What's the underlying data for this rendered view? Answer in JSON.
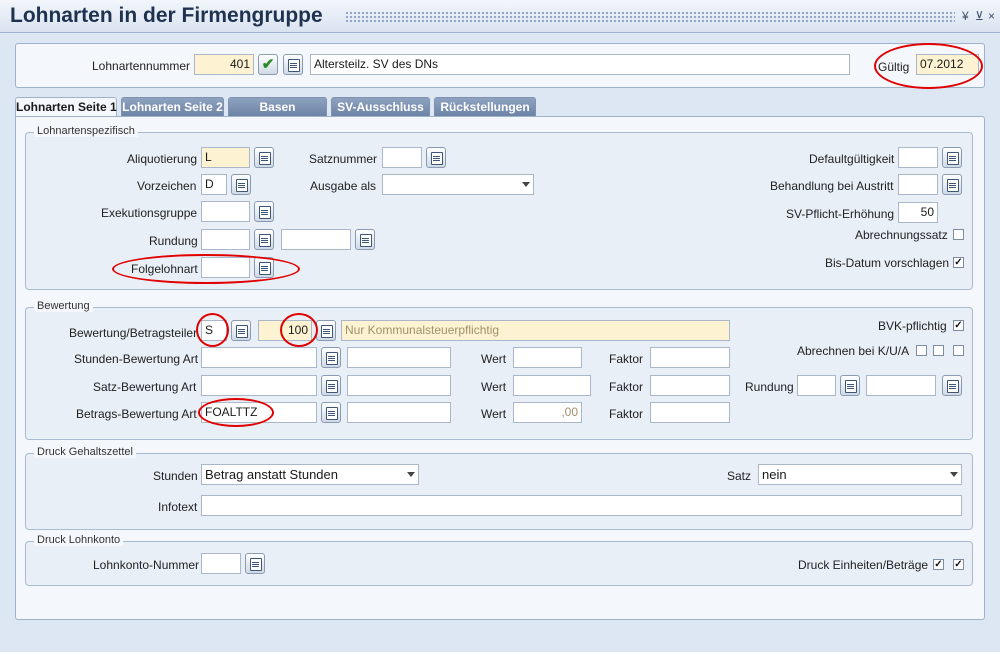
{
  "window": {
    "title": "Lohnarten in der Firmengruppe",
    "controls": [
      "¥",
      "⊻",
      "×"
    ]
  },
  "header": {
    "lohnartennummer_label": "Lohnartennummer",
    "lohnartennummer_value": "401",
    "description_value": "Altersteilz. SV des DNs",
    "gueltig_label": "Gültig",
    "gueltig_value": "07.2012"
  },
  "tabs": [
    {
      "label": "Lohnarten Seite 1",
      "active": true
    },
    {
      "label": "Lohnarten Seite 2",
      "active": false
    },
    {
      "label": "Basen",
      "active": false
    },
    {
      "label": "SV-Ausschluss",
      "active": false
    },
    {
      "label": "Rückstellungen",
      "active": false
    }
  ],
  "lohnartenspezifisch": {
    "legend": "Lohnartenspezifisch",
    "aliquotierung_label": "Aliquotierung",
    "aliquotierung_value": "L",
    "vorzeichen_label": "Vorzeichen",
    "vorzeichen_value": "D",
    "exekutionsgruppe_label": "Exekutionsgruppe",
    "exekutionsgruppe_value": "",
    "rundung_label": "Rundung",
    "rundung_value": "",
    "rundung_value2": "",
    "folgelohnart_label": "Folgelohnart",
    "folgelohnart_value": "",
    "satznummer_label": "Satznummer",
    "satznummer_value": "",
    "ausgabe_als_label": "Ausgabe als",
    "ausgabe_als_value": "",
    "defaultgueltigkeit_label": "Defaultgültigkeit",
    "defaultgueltigkeit_value": "",
    "behandlung_label": "Behandlung bei Austritt",
    "behandlung_value": "",
    "sv_pflicht_label": "SV-Pflicht-Erhöhung",
    "sv_pflicht_value": "50",
    "abrechnungssatz_label": "Abrechnungssatz",
    "abrechnungssatz_checked": false,
    "bis_datum_label": "Bis-Datum vorschlagen",
    "bis_datum_checked": true
  },
  "bewertung": {
    "legend": "Bewertung",
    "betragsteiler_label": "Bewertung/Betragsteiler",
    "betragsteiler_value": "S",
    "betragsteiler_amount": "100",
    "betragsteiler_desc": "Nur Kommunalsteuerpflichtig",
    "stunden_label": "Stunden-Bewertung Art",
    "stunden_value": "",
    "stunden_desc": "",
    "satz_label": "Satz-Bewertung Art",
    "satz_value": "",
    "satz_desc": "",
    "betrags_label": "Betrags-Bewertung Art",
    "betrags_value": "FOALTTZ",
    "betrags_desc": "",
    "wert_label": "Wert",
    "stunden_wert": "",
    "satz_wert": "",
    "betrags_wert": ",00",
    "faktor_label": "Faktor",
    "stunden_faktor": "",
    "satz_faktor": "",
    "betrags_faktor": "",
    "rundung_label": "Rundung",
    "rundung_value": "",
    "rundung_value2": "",
    "bvk_label": "BVK-pflichtig",
    "bvk_checked": true,
    "abrechnen_label": "Abrechnen bei K/U/A",
    "abrechnen_k": false,
    "abrechnen_u": false,
    "abrechnen_a": false
  },
  "druck_gehaltszettel": {
    "legend": "Druck Gehaltszettel",
    "stunden_label": "Stunden",
    "stunden_value": "Betrag anstatt Stunden",
    "satz_label": "Satz",
    "satz_value": "nein",
    "infotext_label": "Infotext",
    "infotext_value": ""
  },
  "druck_lohnkonto": {
    "legend": "Druck Lohnkonto",
    "nummer_label": "Lohnkonto-Nummer",
    "nummer_value": "",
    "einheiten_label": "Druck Einheiten/Beträge",
    "einheiten_checked_1": true,
    "einheiten_checked_2": true
  },
  "colors": {
    "accent": "#1f3350",
    "tab_inactive": "#7d92b3",
    "field_yellow": "#fdf3d2",
    "highlight_ring": "#e00000"
  }
}
